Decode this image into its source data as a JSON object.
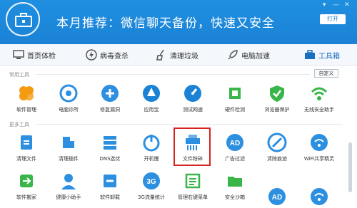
{
  "banner": {
    "text": "本月推荐：微信聊天备份，快速又安全",
    "open_label": "打开"
  },
  "nav": {
    "items": [
      {
        "label": "首页体检",
        "icon": "monitor-icon"
      },
      {
        "label": "病毒查杀",
        "icon": "lightning-icon"
      },
      {
        "label": "清理垃圾",
        "icon": "broom-icon"
      },
      {
        "label": "电脑加速",
        "icon": "rocket-icon"
      },
      {
        "label": "工具箱",
        "icon": "toolbox-icon",
        "active": true
      }
    ]
  },
  "sections": {
    "common_label": "常用工具",
    "custom_label": "自定义",
    "more_label": "更多工具"
  },
  "common_tools": [
    {
      "label": "软件管理",
      "icon": "software-manager-icon",
      "color": "#f39c12"
    },
    {
      "label": "电脑诊所",
      "icon": "stethoscope-icon",
      "color": "#2c8fe0"
    },
    {
      "label": "修复漏洞",
      "icon": "shield-repair-icon",
      "color": "#2c8fe0"
    },
    {
      "label": "应用宝",
      "icon": "app-store-icon",
      "color": "#1b82d6"
    },
    {
      "label": "测试网速",
      "icon": "speedometer-icon",
      "color": "#1b82d6"
    },
    {
      "label": "硬件检测",
      "icon": "chip-icon",
      "color": "#3ab54a"
    },
    {
      "label": "浏览器保护",
      "icon": "browser-shield-icon",
      "color": "#3ab54a"
    },
    {
      "label": "无线安全助手",
      "icon": "wifi-shield-icon",
      "color": "#3ab54a"
    }
  ],
  "more_tools": [
    {
      "label": "清理文件",
      "icon": "clean-file-icon",
      "color": "#2c8fe0"
    },
    {
      "label": "清理插件",
      "icon": "plugin-clean-icon",
      "color": "#2c8fe0"
    },
    {
      "label": "DNS选优",
      "icon": "dns-icon",
      "color": "#2c8fe0"
    },
    {
      "label": "开机慢",
      "icon": "boot-slow-icon",
      "color": "#2c8fe0"
    },
    {
      "label": "文件粉碎",
      "icon": "shredder-icon",
      "color": "#2c8fe0"
    },
    {
      "label": "广告过滤",
      "icon": "ad-filter-icon",
      "color": "#2c8fe0"
    },
    {
      "label": "清除痕迹",
      "icon": "erase-trace-icon",
      "color": "#2c8fe0"
    },
    {
      "label": "WiFi共享精灵",
      "icon": "wifi-share-icon",
      "color": "#2c8fe0"
    },
    {
      "label": "软件搬家",
      "icon": "software-move-icon",
      "color": "#3ab54a"
    },
    {
      "label": "健康小助手",
      "icon": "health-helper-icon",
      "color": "#2c8fe0"
    },
    {
      "label": "软件卸载",
      "icon": "uninstall-icon",
      "color": "#2c8fe0"
    },
    {
      "label": "3G流量统计",
      "icon": "3g-traffic-icon",
      "color": "#2c8fe0"
    },
    {
      "label": "管理右键菜单",
      "icon": "context-menu-icon",
      "color": "#3ab54a"
    },
    {
      "label": "安全沙箱",
      "icon": "sandbox-icon",
      "color": "#3ab54a"
    },
    {
      "label": "",
      "icon": "ad-filter-icon-2",
      "color": "#2c8fe0"
    },
    {
      "label": "",
      "icon": "wifi-icon-2",
      "color": "#2c8fe0"
    }
  ],
  "colors": {
    "banner": "#1b82d6",
    "accent": "#1b6fc2",
    "highlight": "#d6231f"
  }
}
